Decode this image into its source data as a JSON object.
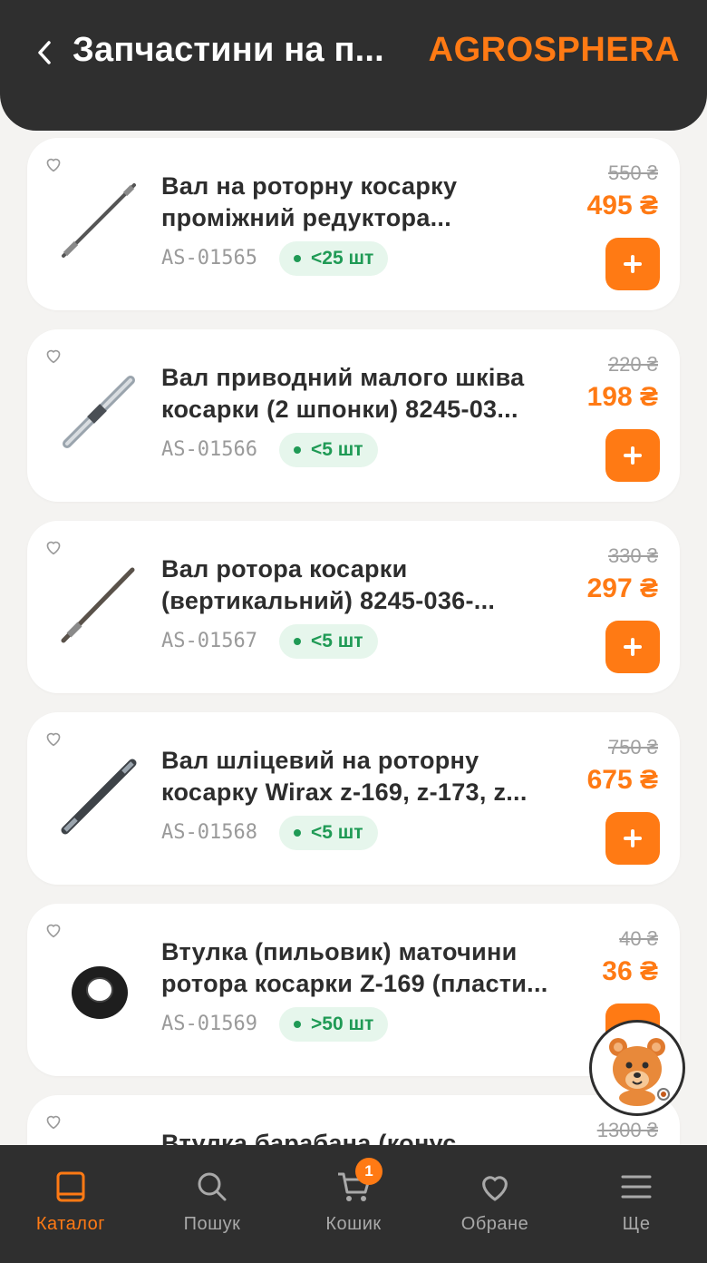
{
  "header": {
    "title": "Запчастини на п...",
    "brand": "AGROSPHERA"
  },
  "products": [
    {
      "name_line1": "Вал на роторну косарку",
      "name_line2": "проміжний редуктора...",
      "sku": "AS-01565",
      "stock": "<25 шт",
      "old_price": "550 ₴",
      "price": "495 ₴",
      "image_icon": "shaft-thin-image"
    },
    {
      "name_line1": "Вал приводний малого шківа",
      "name_line2": "косарки (2 шпонки) 8245-03...",
      "sku": "AS-01566",
      "stock": "<5 шт",
      "old_price": "220 ₴",
      "price": "198 ₴",
      "image_icon": "shaft-keyed-image"
    },
    {
      "name_line1": "Вал ротора косарки",
      "name_line2": "(вертикальний) 8245-036-...",
      "sku": "AS-01567",
      "stock": "<5 шт",
      "old_price": "330 ₴",
      "price": "297 ₴",
      "image_icon": "shaft-thin-image"
    },
    {
      "name_line1": "Вал шліцевий на роторну",
      "name_line2": "косарку Wirax z-169, z-173, z...",
      "sku": "AS-01568",
      "stock": "<5 шт",
      "old_price": "750 ₴",
      "price": "675 ₴",
      "image_icon": "shaft-splined-image"
    },
    {
      "name_line1": "Втулка (пильовик) маточини",
      "name_line2": "ротора косарки Z-169 (пласти...",
      "sku": "AS-01569",
      "stock": ">50 шт",
      "old_price": "40 ₴",
      "price": "36 ₴",
      "image_icon": "bushing-ring-image"
    },
    {
      "name_line1": "Втулка барабана (конус",
      "name_line2": "",
      "sku": "",
      "stock": "",
      "old_price": "1300 ₴",
      "price": "",
      "image_icon": ""
    }
  ],
  "mascot": {
    "icon": "bear-mascot-icon"
  },
  "tabbar": {
    "tabs": [
      {
        "label": "Каталог",
        "icon": "book-icon",
        "active": true
      },
      {
        "label": "Пошук",
        "icon": "search-icon",
        "active": false
      },
      {
        "label": "Кошик",
        "icon": "cart-icon",
        "active": false,
        "badge": "1"
      },
      {
        "label": "Обране",
        "icon": "heart-icon",
        "active": false
      },
      {
        "label": "Ще",
        "icon": "menu-icon",
        "active": false
      }
    ]
  },
  "colors": {
    "accent": "#ff7a14",
    "header_bg": "#2f2f2f",
    "stock_green": "#1f9a55",
    "stock_bg": "#e6f6ec",
    "page_bg": "#f4f3f1"
  }
}
